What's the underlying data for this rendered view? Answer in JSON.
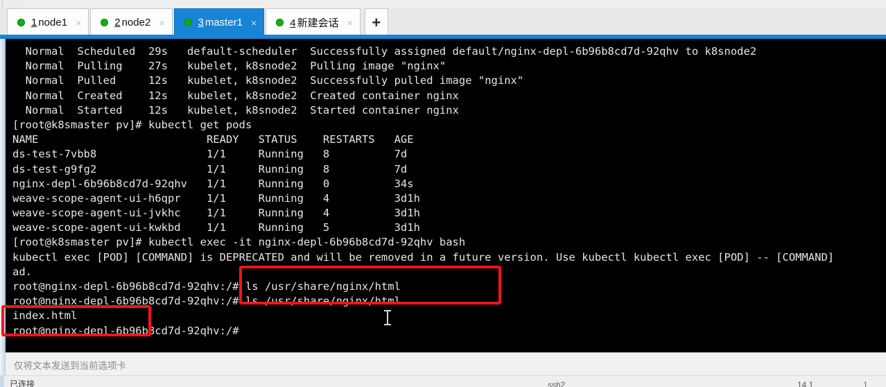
{
  "window": {
    "title_dots": "· · ·"
  },
  "tabs": {
    "items": [
      {
        "index": "1",
        "name": "node1",
        "status": "connected",
        "active": false,
        "close_label": "×"
      },
      {
        "index": "2",
        "name": "node2",
        "status": "connected",
        "active": false,
        "close_label": "×"
      },
      {
        "index": "3",
        "name": "master1",
        "status": "connected",
        "active": true,
        "close_label": "×"
      },
      {
        "index": "4",
        "name": "新建会话",
        "status": "connected",
        "active": false,
        "close_label": "×"
      }
    ],
    "new_tab_label": "+",
    "active_tab_bg": "#1784d6",
    "status_dot_color": "#14ac14"
  },
  "terminal": {
    "background": "#000000",
    "foreground": "#e6e6e6",
    "cursor_color": "#19e019",
    "lines": [
      "  Normal  Scheduled  29s   default-scheduler  Successfully assigned default/nginx-depl-6b96b8cd7d-92qhv to k8snode2",
      "  Normal  Pulling    27s   kubelet, k8snode2  Pulling image \"nginx\"",
      "  Normal  Pulled     12s   kubelet, k8snode2  Successfully pulled image \"nginx\"",
      "  Normal  Created    12s   kubelet, k8snode2  Created container nginx",
      "  Normal  Started    12s   kubelet, k8snode2  Started container nginx",
      "[root@k8smaster pv]# kubectl get pods",
      "NAME                          READY   STATUS    RESTARTS   AGE",
      "ds-test-7vbb8                 1/1     Running   8          7d",
      "ds-test-g9fg2                 1/1     Running   8          7d",
      "nginx-depl-6b96b8cd7d-92qhv   1/1     Running   0          34s",
      "weave-scope-agent-ui-h6qpr    1/1     Running   4          3d1h",
      "weave-scope-agent-ui-jvkhc    1/1     Running   4          3d1h",
      "weave-scope-agent-ui-kwkbd    1/1     Running   5          3d1h",
      "[root@k8smaster pv]# kubectl exec -it nginx-depl-6b96b8cd7d-92qhv bash",
      "kubectl exec [POD] [COMMAND] is DEPRECATED and will be removed in a future version. Use kubectl kubectl exec [POD] -- [COMMAND]",
      "ad.",
      "root@nginx-depl-6b96b8cd7d-92qhv:/# ls /usr/share/nginx/html",
      "root@nginx-depl-6b96b8cd7d-92qhv:/# ls /usr/share/nginx/html",
      "index.html",
      "root@nginx-depl-6b96b8cd7d-92qhv:/# "
    ]
  },
  "annotations": {
    "box_color": "#f51414",
    "boxes": [
      {
        "id": "redbox-cmd",
        "highlights": "ls /usr/share/nginx/html command lines"
      },
      {
        "id": "redbox-out",
        "highlights": "index.html output line"
      }
    ]
  },
  "send_bar": {
    "hint": "仅将文本发送到当前选项卡",
    "input_value": ""
  },
  "status_bar": {
    "left": "已连接",
    "middle": "ssh2",
    "right": "14,1",
    "far_right": "1"
  }
}
